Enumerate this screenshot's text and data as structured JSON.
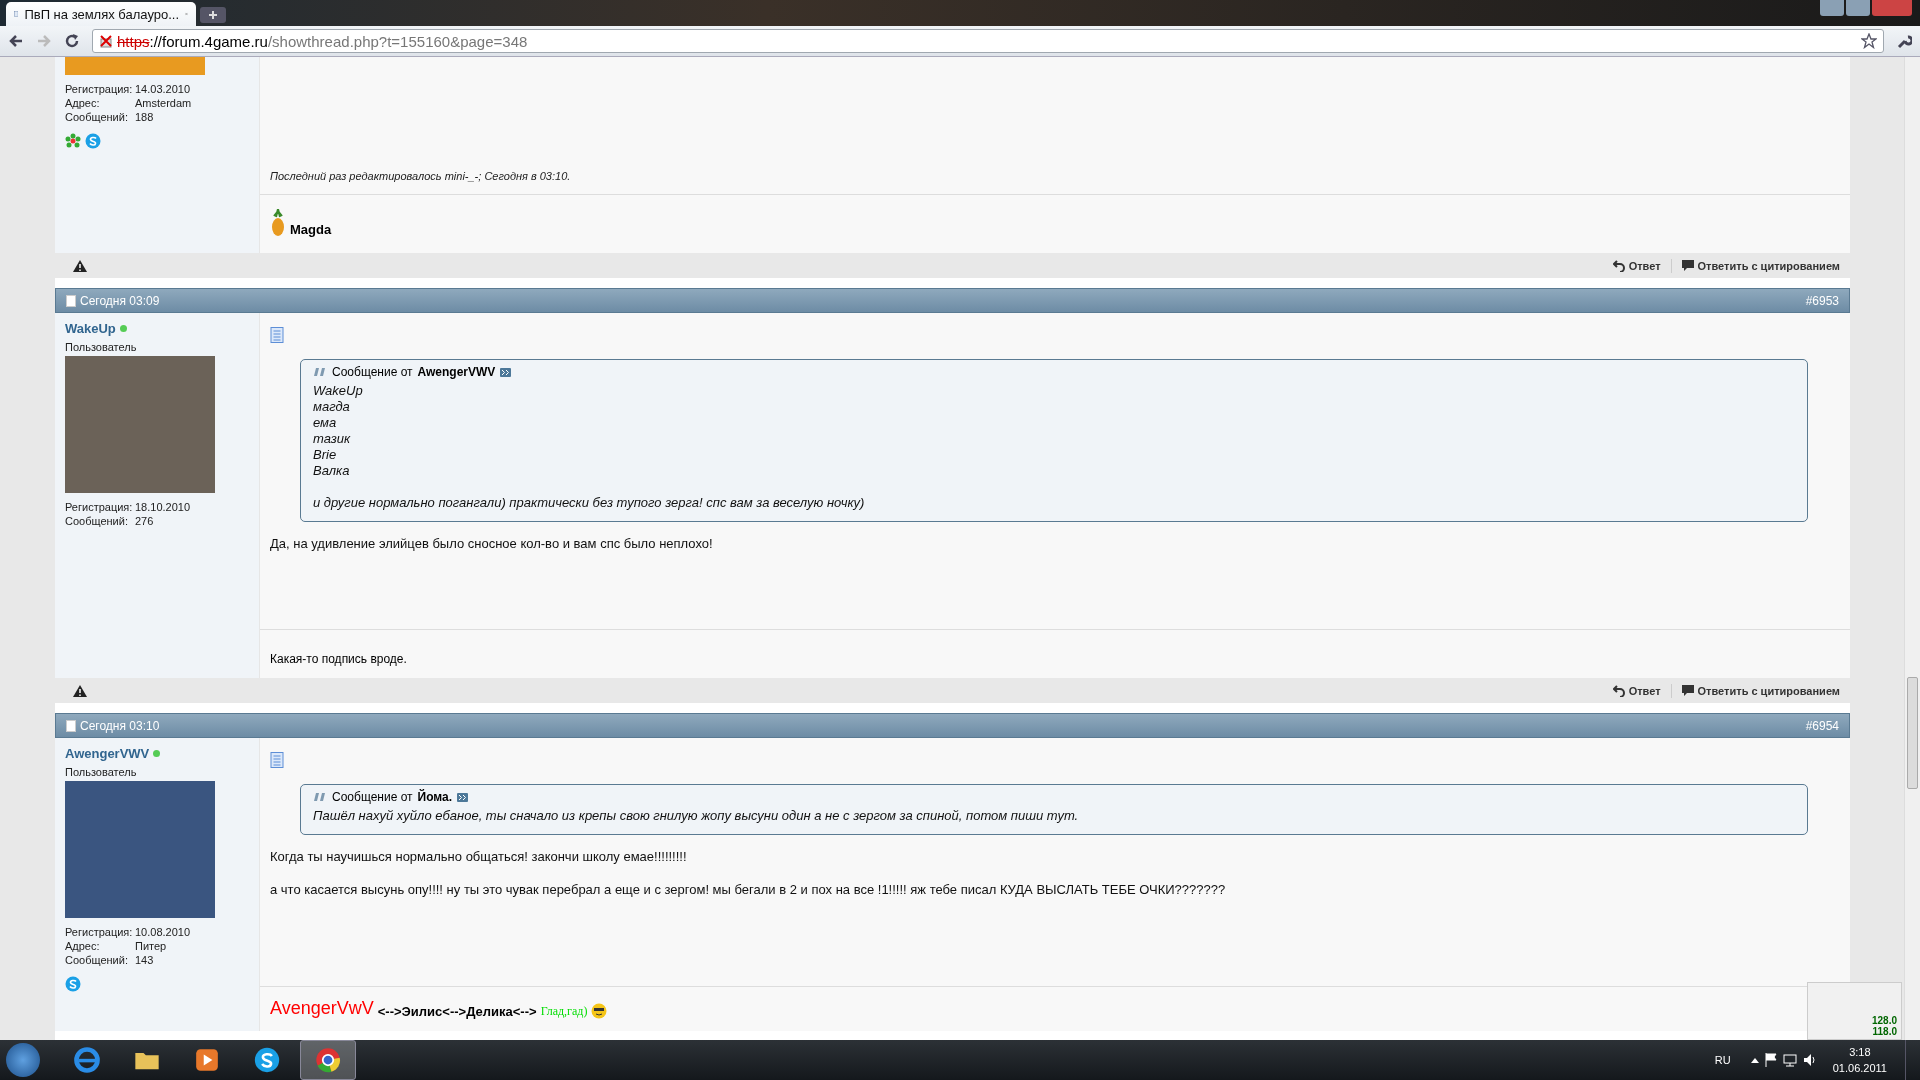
{
  "browser": {
    "tab_title": "ПвП на землях балауро...",
    "url_scheme": "https",
    "url_host": "://forum.4game.ru",
    "url_path": "/showthread.php?t=155160&page=348"
  },
  "posts": [
    {
      "user": {
        "avatar": {
          "kind": "cropped"
        },
        "fields": [
          {
            "label": "Регистрация:",
            "value": "14.03.2010"
          },
          {
            "label": "Адрес:",
            "value": "Amsterdam"
          },
          {
            "label": "Сообщений:",
            "value": "188"
          }
        ],
        "contacts": [
          {
            "kind": "icq"
          },
          {
            "kind": "skype"
          }
        ]
      },
      "edit_note": "Последний раз редактировалось mini-_-; Сегодня в 03:10.",
      "signature": [
        {
          "kind": "pineapple"
        },
        {
          "kind": "bold",
          "text": "Magda"
        }
      ],
      "actions": [
        "Ответ",
        "Ответить с цитированием"
      ]
    },
    {
      "header": {
        "date": "Сегодня 03:09",
        "number": "#6953"
      },
      "user": {
        "name": "WakeUp",
        "online": true,
        "rank": "Пользователь",
        "avatar": {
          "kind": "full"
        },
        "fields": [
          {
            "label": "Регистрация:",
            "value": "18.10.2010"
          },
          {
            "label": "Сообщений:",
            "value": "276"
          }
        ]
      },
      "quote": {
        "prefix": "Сообщение от",
        "author": "AwengerVWV",
        "blocks": [
          [
            "WakeUp",
            "магда",
            "ема",
            "тазик",
            "Brie",
            "Валка"
          ],
          [
            "и другие нормально погангали) практически без тупого зерга! спс вам за веселую ночку)"
          ]
        ]
      },
      "message": [
        "Да, на удивление элийцев было сносное кол-во и вам спс было неплохо!"
      ],
      "signature": [
        {
          "kind": "plain",
          "text": "Какая-то подпись вроде."
        }
      ],
      "actions": [
        "Ответ",
        "Ответить с цитированием"
      ]
    },
    {
      "header": {
        "date": "Сегодня 03:10",
        "number": "#6954"
      },
      "user": {
        "name": "AwengerVWV",
        "online": true,
        "rank": "Пользователь",
        "avatar": {
          "kind": "full"
        },
        "fields": [
          {
            "label": "Регистрация:",
            "value": "10.08.2010"
          },
          {
            "label": "Адрес:",
            "value": "Питер"
          },
          {
            "label": "Сообщений:",
            "value": "143"
          }
        ],
        "contacts": [
          {
            "kind": "skype"
          }
        ]
      },
      "quote": {
        "prefix": "Сообщение от",
        "author": "Йома.",
        "blocks": [
          [
            "Пашёл нахуй хуйло ебаное, ты сначало из крепы свою гнилую жопу высуни один а не с зергом за спиной, потом пиши тут."
          ]
        ]
      },
      "message": [
        "Когда ты научишься нормально общаться! закончи школу емае!!!!!!!!!",
        "а что касается высунь опу!!!! ну ты это чувак перебрал а еще и с зергом! мы бегали в 2 и пох на все !1!!!!! яж тебе писал КУДА ВЫСЛАТЬ ТЕБЕ ОЧКИ???????"
      ],
      "signature": [
        {
          "kind": "big",
          "text": "AvengerVwV",
          "color": "#ff0000"
        },
        {
          "kind": "bold",
          "text": "<-->Эилис<-->Делика<-->"
        },
        {
          "kind": "serif",
          "text": "Глад,гад)",
          "color": "#00dd00"
        },
        {
          "kind": "smiley"
        }
      ]
    }
  ],
  "gadget": {
    "readings": [
      "128.0",
      "118.0"
    ]
  },
  "taskbar": {
    "apps": [
      {
        "kind": "ie",
        "selected": false
      },
      {
        "kind": "folder",
        "selected": false
      },
      {
        "kind": "player",
        "selected": false
      },
      {
        "kind": "skype",
        "selected": false
      },
      {
        "kind": "chrome",
        "selected": true
      }
    ],
    "language": "RU",
    "time": "3:18",
    "date": "01.06.2011"
  }
}
